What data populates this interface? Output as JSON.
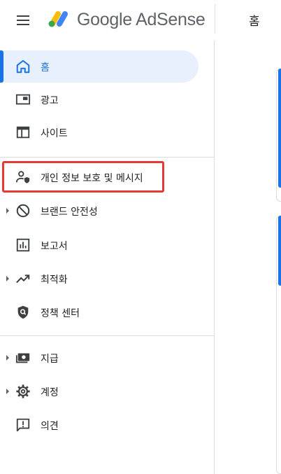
{
  "header": {
    "menu_icon": "hamburger-menu-icon",
    "logo_text": "Google AdSense",
    "page_title": "홈"
  },
  "sidebar": {
    "items": [
      {
        "label": "홈",
        "icon": "home-icon",
        "active": true
      },
      {
        "label": "광고",
        "icon": "ad-unit-icon"
      },
      {
        "label": "사이트",
        "icon": "site-layout-icon"
      },
      {
        "label": "개인 정보 보호 및 메시지",
        "icon": "person-shield-icon",
        "highlighted": true
      },
      {
        "label": "브랜드 안전성",
        "icon": "block-icon",
        "expandable": true
      },
      {
        "label": "보고서",
        "icon": "bar-chart-icon"
      },
      {
        "label": "최적화",
        "icon": "trending-up-icon",
        "expandable": true
      },
      {
        "label": "정책 센터",
        "icon": "policy-shield-icon"
      },
      {
        "label": "지급",
        "icon": "payments-icon",
        "expandable": true
      },
      {
        "label": "계정",
        "icon": "settings-gear-icon",
        "expandable": true
      },
      {
        "label": "의견",
        "icon": "feedback-icon"
      }
    ]
  },
  "colors": {
    "accent": "#1a73e8",
    "active_bg": "#e8f0fe",
    "highlight": "#e53935"
  }
}
